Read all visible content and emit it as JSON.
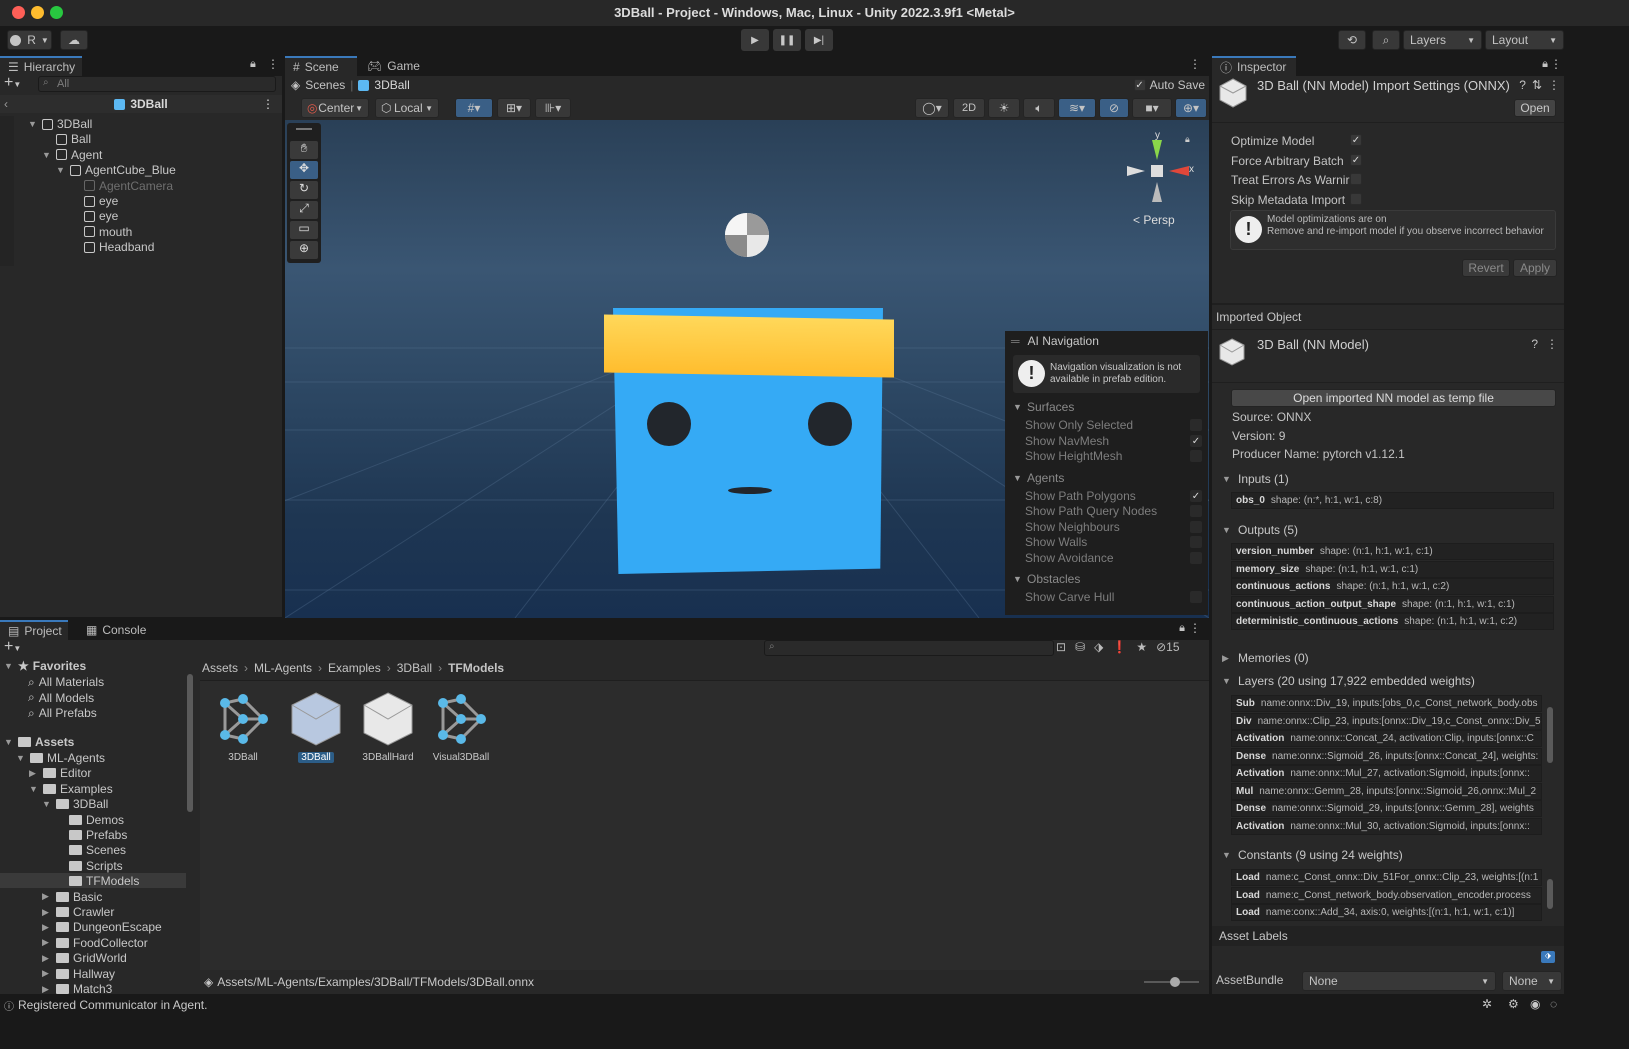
{
  "window": {
    "title": "3DBall - Project - Windows, Mac, Linux - Unity 2022.3.9f1 <Metal>"
  },
  "toolbar": {
    "account_label": "R",
    "layers_label": "Layers",
    "layout_label": "Layout"
  },
  "hierarchy": {
    "tab_label": "Hierarchy",
    "search_placeholder": "All",
    "scene_name": "3DBall",
    "items": [
      {
        "label": "3DBall",
        "depth": 1,
        "expanded": true
      },
      {
        "label": "Ball",
        "depth": 2
      },
      {
        "label": "Agent",
        "depth": 2,
        "expanded": true
      },
      {
        "label": "AgentCube_Blue",
        "depth": 3,
        "expanded": true
      },
      {
        "label": "AgentCamera",
        "depth": 4,
        "dimmed": true
      },
      {
        "label": "eye",
        "depth": 4
      },
      {
        "label": "eye",
        "depth": 4
      },
      {
        "label": "mouth",
        "depth": 4
      },
      {
        "label": "Headband",
        "depth": 4
      }
    ]
  },
  "scene": {
    "tab_scene": "Scene",
    "tab_game": "Game",
    "breadcrumb_root": "Scenes",
    "breadcrumb_current": "3DBall",
    "auto_save_label": "Auto Save",
    "pivot_label": "Center",
    "space_label": "Local",
    "mode_2d_label": "2D",
    "persp_label": "< Persp",
    "gizmo_x": "x",
    "gizmo_y": "y"
  },
  "ai_navigation": {
    "title": "AI Navigation",
    "warning": "Navigation visualization is not available in prefab edition.",
    "surfaces_header": "Surfaces",
    "surfaces": [
      {
        "label": "Show Only Selected",
        "checked": false
      },
      {
        "label": "Show NavMesh",
        "checked": true
      },
      {
        "label": "Show HeightMesh",
        "checked": false
      }
    ],
    "agents_header": "Agents",
    "agents": [
      {
        "label": "Show Path Polygons",
        "checked": true
      },
      {
        "label": "Show Path Query Nodes",
        "checked": false
      },
      {
        "label": "Show Neighbours",
        "checked": false
      },
      {
        "label": "Show Walls",
        "checked": false
      },
      {
        "label": "Show Avoidance",
        "checked": false
      }
    ],
    "obstacles_header": "Obstacles",
    "obstacles": [
      {
        "label": "Show Carve Hull",
        "checked": false
      }
    ]
  },
  "project": {
    "tab_project": "Project",
    "tab_console": "Console",
    "hidden_count": "15",
    "favorites_label": "Favorites",
    "favorites": [
      "All Materials",
      "All Models",
      "All Prefabs"
    ],
    "assets_label": "Assets",
    "tree": [
      {
        "label": "ML-Agents",
        "depth": 1,
        "expanded": true
      },
      {
        "label": "Editor",
        "depth": 2
      },
      {
        "label": "Examples",
        "depth": 2,
        "expanded": true
      },
      {
        "label": "3DBall",
        "depth": 3,
        "expanded": true
      },
      {
        "label": "Demos",
        "depth": 4
      },
      {
        "label": "Prefabs",
        "depth": 4
      },
      {
        "label": "Scenes",
        "depth": 4
      },
      {
        "label": "Scripts",
        "depth": 4
      },
      {
        "label": "TFModels",
        "depth": 4,
        "selected": true
      },
      {
        "label": "Basic",
        "depth": 3
      },
      {
        "label": "Crawler",
        "depth": 3
      },
      {
        "label": "DungeonEscape",
        "depth": 3
      },
      {
        "label": "FoodCollector",
        "depth": 3
      },
      {
        "label": "GridWorld",
        "depth": 3
      },
      {
        "label": "Hallway",
        "depth": 3
      },
      {
        "label": "Match3",
        "depth": 3
      }
    ],
    "breadcrumb": [
      "Assets",
      "ML-Agents",
      "Examples",
      "3DBall",
      "TFModels"
    ],
    "assets": [
      {
        "label": "3DBall",
        "kind": "network"
      },
      {
        "label": "3DBall",
        "kind": "model",
        "selected": true
      },
      {
        "label": "3DBallHard",
        "kind": "model"
      },
      {
        "label": "Visual3DBall",
        "kind": "network"
      }
    ],
    "path": "Assets/ML-Agents/Examples/3DBall/TFModels/3DBall.onnx"
  },
  "inspector": {
    "tab_label": "Inspector",
    "title": "3D Ball (NN Model) Import Settings (ONNX)",
    "open_label": "Open",
    "options": [
      {
        "label": "Optimize Model",
        "checked": true
      },
      {
        "label": "Force Arbitrary Batch",
        "checked": true
      },
      {
        "label": "Treat Errors As Warnir",
        "checked": false
      },
      {
        "label": "Skip Metadata Import",
        "checked": false
      }
    ],
    "info_title": "Model optimizations are on",
    "info_body": "Remove and re-import model if you observe incorrect behavior",
    "revert_label": "Revert",
    "apply_label": "Apply",
    "imported_object_header": "Imported Object",
    "imported_object_name": "3D Ball (NN Model)",
    "open_temp_label": "Open imported NN model as temp file",
    "source": "Source: ONNX",
    "version": "Version: 9",
    "producer": "Producer Name: pytorch v1.12.1",
    "inputs_header": "Inputs (1)",
    "inputs": [
      {
        "name": "obs_0",
        "value": "shape: (n:*, h:1, w:1, c:8)"
      }
    ],
    "outputs_header": "Outputs (5)",
    "outputs": [
      {
        "name": "version_number",
        "value": "shape: (n:1, h:1, w:1, c:1)"
      },
      {
        "name": "memory_size",
        "value": "shape: (n:1, h:1, w:1, c:1)"
      },
      {
        "name": "continuous_actions",
        "value": "shape: (n:1, h:1, w:1, c:2)"
      },
      {
        "name": "continuous_action_output_shape",
        "value": "shape: (n:1, h:1, w:1, c:1)"
      },
      {
        "name": "deterministic_continuous_actions",
        "value": "shape: (n:1, h:1, w:1, c:2)"
      }
    ],
    "memories_header": "Memories (0)",
    "layers_header": "Layers (20 using 17,922 embedded weights)",
    "layers": [
      {
        "name": "Sub",
        "value": "name:onnx::Div_19, inputs:[obs_0,c_Const_network_body.obs"
      },
      {
        "name": "Div",
        "value": "name:onnx::Clip_23, inputs:[onnx::Div_19,c_Const_onnx::Div_5"
      },
      {
        "name": "Activation",
        "value": "name:onnx::Concat_24, activation:Clip, inputs:[onnx::C"
      },
      {
        "name": "Dense",
        "value": "name:onnx::Sigmoid_26, inputs:[onnx::Concat_24], weights:"
      },
      {
        "name": "Activation",
        "value": "name:onnx::Mul_27, activation:Sigmoid, inputs:[onnx::"
      },
      {
        "name": "Mul",
        "value": "name:onnx::Gemm_28, inputs:[onnx::Sigmoid_26,onnx::Mul_2"
      },
      {
        "name": "Dense",
        "value": "name:onnx::Sigmoid_29, inputs:[onnx::Gemm_28], weights"
      },
      {
        "name": "Activation",
        "value": "name:onnx::Mul_30, activation:Sigmoid, inputs:[onnx::"
      }
    ],
    "constants_header": "Constants (9 using 24 weights)",
    "constants": [
      {
        "name": "Load",
        "value": "name:c_Const_onnx::Div_51For_onnx::Clip_23, weights:[(n:1"
      },
      {
        "name": "Load",
        "value": "name:c_Const_network_body.observation_encoder.process"
      },
      {
        "name": "Load",
        "value": "name:conx::Add_34, axis:0, weights:[(n:1, h:1, w:1, c:1)]"
      }
    ],
    "asset_labels_header": "Asset Labels",
    "assetbundle_label": "AssetBundle",
    "assetbundle_value": "None",
    "assetbundle_variant": "None"
  },
  "status": {
    "message": "Registered Communicator in Agent."
  },
  "colors": {
    "accent": "#3a79bb",
    "cube_blue": "#35aaf5",
    "headband": "#ffc53d"
  }
}
